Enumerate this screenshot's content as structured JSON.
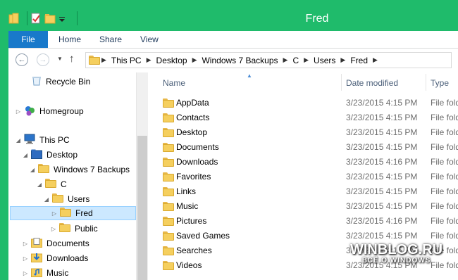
{
  "window": {
    "title": "Fred"
  },
  "ribbon": {
    "tabs": [
      "File",
      "Home",
      "Share",
      "View"
    ]
  },
  "address": {
    "crumbs": [
      "This PC",
      "Desktop",
      "Windows 7 Backups",
      "C",
      "Users",
      "Fred"
    ]
  },
  "nav": {
    "items": [
      {
        "label": "Recycle Bin",
        "icon": "recycle-bin-icon"
      },
      {
        "label": "Homegroup",
        "icon": "homegroup-icon"
      },
      {
        "label": "This PC",
        "icon": "computer-icon"
      },
      {
        "label": "Desktop",
        "icon": "desktop-folder-icon"
      },
      {
        "label": "Windows 7 Backups",
        "icon": "folder-icon"
      },
      {
        "label": "C",
        "icon": "folder-icon"
      },
      {
        "label": "Users",
        "icon": "folder-icon"
      },
      {
        "label": "Fred",
        "icon": "folder-icon"
      },
      {
        "label": "Public",
        "icon": "folder-icon"
      },
      {
        "label": "Documents",
        "icon": "documents-icon"
      },
      {
        "label": "Downloads",
        "icon": "downloads-icon"
      },
      {
        "label": "Music",
        "icon": "music-icon"
      }
    ]
  },
  "columns": {
    "name": "Name",
    "date": "Date modified",
    "type": "Type"
  },
  "files": [
    {
      "name": "AppData",
      "date": "3/23/2015 4:15 PM",
      "type": "File folder"
    },
    {
      "name": "Contacts",
      "date": "3/23/2015 4:15 PM",
      "type": "File folder"
    },
    {
      "name": "Desktop",
      "date": "3/23/2015 4:15 PM",
      "type": "File folder"
    },
    {
      "name": "Documents",
      "date": "3/23/2015 4:15 PM",
      "type": "File folder"
    },
    {
      "name": "Downloads",
      "date": "3/23/2015 4:16 PM",
      "type": "File folder"
    },
    {
      "name": "Favorites",
      "date": "3/23/2015 4:15 PM",
      "type": "File folder"
    },
    {
      "name": "Links",
      "date": "3/23/2015 4:15 PM",
      "type": "File folder"
    },
    {
      "name": "Music",
      "date": "3/23/2015 4:15 PM",
      "type": "File folder"
    },
    {
      "name": "Pictures",
      "date": "3/23/2015 4:16 PM",
      "type": "File folder"
    },
    {
      "name": "Saved Games",
      "date": "3/23/2015 4:15 PM",
      "type": "File folder"
    },
    {
      "name": "Searches",
      "date": "3/23/2015 4:15 PM",
      "type": "File folder"
    },
    {
      "name": "Videos",
      "date": "3/23/2015 4:15 PM",
      "type": "File folder"
    }
  ],
  "watermark": {
    "line1": "WINBLOG.RU",
    "line2": "ВСЁ О WINDOWS"
  },
  "colors": {
    "accent": "#1fbb6b",
    "file_tab": "#1979ca",
    "selection": "#cce8ff"
  }
}
